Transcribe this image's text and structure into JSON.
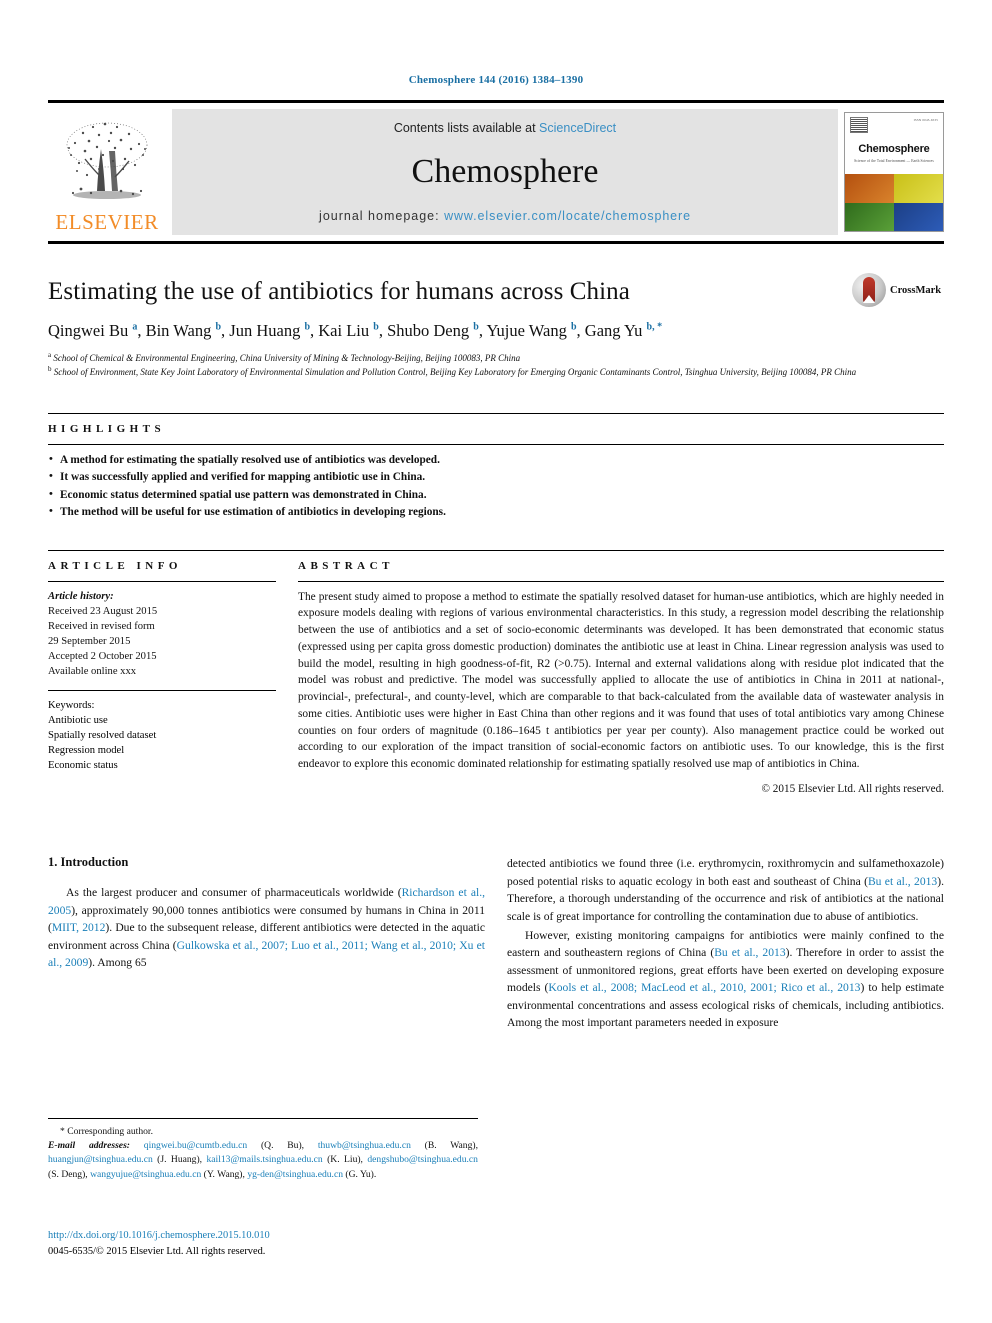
{
  "running_head": "Chemosphere 144 (2016) 1384–1390",
  "header": {
    "publisher_name": "ELSEVIER",
    "contents_prefix": "Contents lists available at ",
    "contents_link": "ScienceDirect",
    "journal_name": "Chemosphere",
    "homepage_prefix": "journal homepage: ",
    "homepage_url": "www.elsevier.com/locate/chemosphere",
    "cover": {
      "title": "Chemosphere",
      "subtitle": "Science of the Total Environment — Earth Sciences",
      "corner_text": "ISSN 0045-6535"
    },
    "accent_link_color": "#3a8fc4",
    "elsevier_orange": "#f28c28"
  },
  "article": {
    "title": "Estimating the use of antibiotics for humans across China",
    "authors_html": "Qingwei Bu <sup>a</sup>, Bin Wang <sup>b</sup>, Jun Huang <sup>b</sup>, Kai Liu <sup>b</sup>, Shubo Deng <sup>b</sup>, Yujue Wang <sup>b</sup>, Gang Yu <sup>b, *</sup>",
    "affiliation_a": "School of Chemical & Environmental Engineering, China University of Mining & Technology-Beijing, Beijing 100083, PR China",
    "affiliation_b": "School of Environment, State Key Joint Laboratory of Environmental Simulation and Pollution Control, Beijing Key Laboratory for Emerging Organic Contaminants Control, Tsinghua University, Beijing 100084, PR China",
    "crossmark_label": "CrossMark"
  },
  "highlights": {
    "label": "HIGHLIGHTS",
    "items": [
      "A method for estimating the spatially resolved use of antibiotics was developed.",
      "It was successfully applied and verified for mapping antibiotic use in China.",
      "Economic status determined spatial use pattern was demonstrated in China.",
      "The method will be useful for use estimation of antibiotics in developing regions."
    ]
  },
  "article_info": {
    "label": "ARTICLE INFO",
    "history_label": "Article history:",
    "history": [
      "Received 23 August 2015",
      "Received in revised form",
      "29 September 2015",
      "Accepted 2 October 2015",
      "Available online xxx"
    ],
    "keywords_label": "Keywords:",
    "keywords": [
      "Antibiotic use",
      "Spatially resolved dataset",
      "Regression model",
      "Economic status"
    ]
  },
  "abstract": {
    "label": "ABSTRACT",
    "text": "The present study aimed to propose a method to estimate the spatially resolved dataset for human-use antibiotics, which are highly needed in exposure models dealing with regions of various environmental characteristics. In this study, a regression model describing the relationship between the use of antibiotics and a set of socio-economic determinants was developed. It has been demonstrated that economic status (expressed using per capita gross domestic production) dominates the antibiotic use at least in China. Linear regression analysis was used to build the model, resulting in high goodness-of-fit, R2 (>0.75). Internal and external validations along with residue plot indicated that the model was robust and predictive. The model was successfully applied to allocate the use of antibiotics in China in 2011 at national-, provincial-, prefectural-, and county-level, which are comparable to that back-calculated from the available data of wastewater analysis in some cities. Antibiotic uses were higher in East China than other regions and it was found that uses of total antibiotics vary among Chinese counties on four orders of magnitude (0.186–1645 t antibiotics per year per county). Also management practice could be worked out according to our exploration of the impact transition of social-economic factors on antibiotic uses. To our knowledge, this is the first endeavor to explore this economic dominated relationship for estimating spatially resolved use map of antibiotics in China.",
    "copyright": "© 2015 Elsevier Ltd. All rights reserved."
  },
  "introduction": {
    "heading": "1. Introduction",
    "left_paragraph_html": "As the largest producer and consumer of pharmaceuticals worldwide (<span class=\"ref\">Richardson et al., 2005</span>), approximately 90,000 tonnes antibiotics were consumed by humans in China in 2011 (<span class=\"ref\">MIIT, 2012</span>). Due to the subsequent release, different antibiotics were detected in the aquatic environment across China (<span class=\"ref\">Gulkowska et al., 2007; Luo et al., 2011; Wang et al., 2010; Xu et al., 2009</span>). Among 65",
    "right_paragraph1_html": "detected antibiotics we found three (i.e. erythromycin, roxithromycin and sulfamethoxazole) posed potential risks to aquatic ecology in both east and southeast of China (<span class=\"ref\">Bu et al., 2013</span>). Therefore, a thorough understanding of the occurrence and risk of antibiotics at the national scale is of great importance for controlling the contamination due to abuse of antibiotics.",
    "right_paragraph2_html": "However, existing monitoring campaigns for antibiotics were mainly confined to the eastern and southeastern regions of China (<span class=\"ref\">Bu et al., 2013</span>). Therefore in order to assist the assessment of unmonitored regions, great efforts have been exerted on developing exposure models (<span class=\"ref\">Kools et al., 2008; MacLeod et al., 2010, 2001; Rico et al., 2013</span>) to help estimate environmental concentrations and assess ecological risks of chemicals, including antibiotics. Among the most important parameters needed in exposure"
  },
  "footnote": {
    "corresponding": "* Corresponding author.",
    "emails_label": "E-mail addresses:",
    "emails_html": "<span class=\"ref\">qingwei.bu@cumtb.edu.cn</span> (Q. Bu), <span class=\"ref\">thuwb@tsinghua.edu.cn</span> (B. Wang), <span class=\"ref\">huangjun@tsinghua.edu.cn</span> (J. Huang), <span class=\"ref\">kail13@mails.tsinghua.edu.cn</span> (K. Liu), <span class=\"ref\">dengshubo@tsinghua.edu.cn</span> (S. Deng), <span class=\"ref\">wangyujue@tsinghua.edu.cn</span> (Y. Wang), <span class=\"ref\">yg-den@tsinghua.edu.cn</span> (G. Yu)."
  },
  "doi_block": {
    "doi": "http://dx.doi.org/10.1016/j.chemosphere.2015.10.010",
    "issn_line": "0045-6535/© 2015 Elsevier Ltd. All rights reserved."
  }
}
